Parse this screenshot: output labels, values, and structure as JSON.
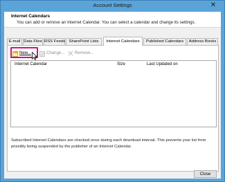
{
  "window": {
    "title": "Account Settings",
    "close_glyph": "✕"
  },
  "header": {
    "title": "Internet Calendars",
    "description": "You can add or remove an Internet Calendar. You can select a calendar and change its settings."
  },
  "tabs": [
    {
      "label": "E-mail"
    },
    {
      "label": "Data Files"
    },
    {
      "label": "RSS Feeds"
    },
    {
      "label": "SharePoint Lists"
    },
    {
      "label": "Internet Calendars",
      "active": true
    },
    {
      "label": "Published Calendars"
    },
    {
      "label": "Address Books"
    }
  ],
  "toolbar": {
    "new_label": "New...",
    "change_label": "Change...",
    "remove_label": "Remove..."
  },
  "list": {
    "columns": [
      "Internet Calendar",
      "Size",
      "Last Updated on"
    ]
  },
  "info_text": "Subscribed Internet Calendars are checked once during each download interval. This prevents your list from possibly being suspended by the publisher of an Internet Calendar.",
  "footer": {
    "close_label": "Close"
  },
  "colors": {
    "titlebar": "#5ba4d8",
    "highlight": "#c9157d",
    "remove_x": "#c9c9c9"
  }
}
